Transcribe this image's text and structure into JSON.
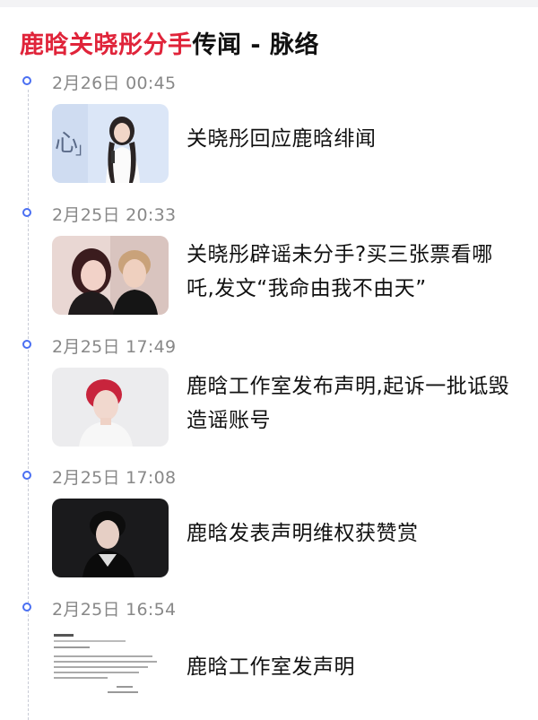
{
  "title": {
    "highlight": "鹿晗关晓彤分手",
    "rest": "传闻 - 脉络"
  },
  "events": [
    {
      "time": "2月26日 00:45",
      "headline": "关晓彤回应鹿晗绯闻",
      "thumb_icon": "press-conference-photo"
    },
    {
      "time": "2月25日 20:33",
      "headline": "关晓彤辟谣未分手?买三张票看哪吒,发文“我命由我不由天”",
      "thumb_icon": "couple-photo"
    },
    {
      "time": "2月25日 17:49",
      "headline": "鹿晗工作室发布声明,起诉一批诋毁造谣账号",
      "thumb_icon": "portrait-photo"
    },
    {
      "time": "2月25日 17:08",
      "headline": "鹿晗发表声明维权获赞赏",
      "thumb_icon": "dark-portrait-photo"
    },
    {
      "time": "2月25日 16:54",
      "headline": "鹿晗工作室发声明",
      "thumb_icon": "statement-document-image"
    }
  ],
  "colors": {
    "accent": "#e0243a",
    "timeline_dot": "#4a6ff2",
    "time_text": "#888888"
  }
}
